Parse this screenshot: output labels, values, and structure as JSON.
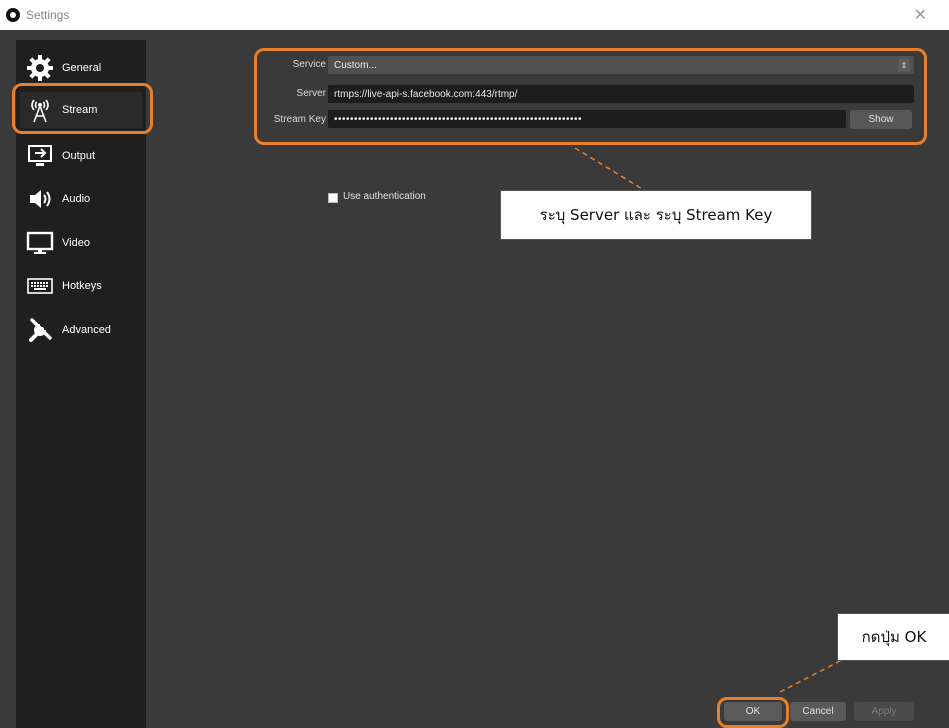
{
  "window": {
    "title": "Settings",
    "close_glyph": "✕"
  },
  "sidebar": {
    "items": [
      {
        "label": "General",
        "icon": "gear-icon"
      },
      {
        "label": "Stream",
        "icon": "antenna-icon"
      },
      {
        "label": "Output",
        "icon": "output-icon"
      },
      {
        "label": "Audio",
        "icon": "speaker-icon"
      },
      {
        "label": "Video",
        "icon": "monitor-icon"
      },
      {
        "label": "Hotkeys",
        "icon": "keyboard-icon"
      },
      {
        "label": "Advanced",
        "icon": "tools-icon"
      }
    ],
    "active": "Stream"
  },
  "stream": {
    "service_label": "Service",
    "service_value": "Custom...",
    "server_label": "Server",
    "server_value": "rtmps://live-api-s.facebook.com:443/rtmp/",
    "key_label": "Stream Key",
    "key_value": "••••••••••••••••••••••••••••••••••••••••••••••••••••••••••••••",
    "show_label": "Show",
    "auth_label": "Use authentication"
  },
  "footer": {
    "ok_label": "OK",
    "cancel_label": "Cancel",
    "apply_label": "Apply"
  },
  "annotations": {
    "server_key_note": "ระบุ Server และ ระบุ Stream Key",
    "ok_note": "กดปุ่ม OK",
    "highlight_color": "#e8802a"
  }
}
